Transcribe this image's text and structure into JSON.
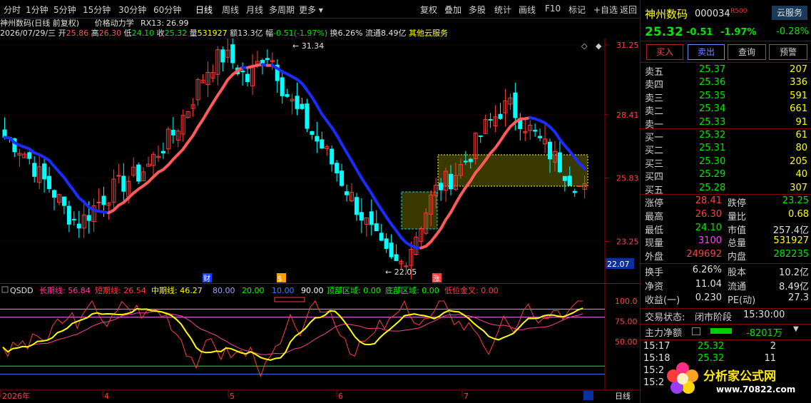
{
  "toolbar": {
    "periods": [
      "分时",
      "1分钟",
      "5分钟",
      "15分钟",
      "30分钟",
      "60分钟",
      "日线",
      "周线",
      "月线",
      "多周期",
      "更多"
    ],
    "active_period": "日线",
    "actions": [
      "复权",
      "叠加",
      "多股",
      "统计",
      "画线",
      "F10",
      "标记",
      "+自选",
      "返回"
    ]
  },
  "title_line": {
    "stock": "神州数码(日线 前复权)",
    "indicator": "价格动力学",
    "rx13_label": "RX13:",
    "rx13_value": "26.99"
  },
  "quote_line": {
    "date": "2026/07/29/三",
    "open_label": "开",
    "open": "25.86",
    "high_label": "高",
    "high": "26.30",
    "low_label": "低",
    "low": "24.10",
    "close_label": "收",
    "close": "25.32",
    "vol_label": "量",
    "vol": "531927",
    "amt_label": "额",
    "amt": "13.3亿",
    "chg_label": "幅",
    "chg": "-0.51(-1.97%)",
    "turn_label": "换",
    "turn": "6.26%",
    "float_label": "流通",
    "float": "8.49亿",
    "service": "其他云服务"
  },
  "price_axis": {
    "ticks": [
      "31.25",
      "28.41",
      "25.83",
      "23.25"
    ],
    "current": "22.07",
    "high_marker": "31.34",
    "low_marker": "22.05"
  },
  "event_markers": [
    "财",
    "$",
    "涨"
  ],
  "indicator_panel": {
    "name": "QSDD",
    "long_label": "长期线:",
    "long_value": "56.84",
    "short_label": "短期线:",
    "short_value": "26.54",
    "mid_label": "中期线:",
    "mid_value": "46.27",
    "levels": [
      "80.00",
      "20.00",
      "10.00",
      "90.00"
    ],
    "top_zone_label": "顶部区域:",
    "top_zone": "0.00",
    "bottom_zone_label": "底部区域:",
    "bottom_zone": "0.00",
    "gold_label": "低位金叉:",
    "gold": "0.00",
    "ticks": [
      "100.0",
      "75.00",
      "50.00"
    ]
  },
  "time_axis": {
    "labels": [
      "2026年",
      "4",
      "5",
      "6",
      "7"
    ],
    "period": "日线"
  },
  "right_panel": {
    "name": "神州数码",
    "code": "000034",
    "r_badge": "R500",
    "cloud_btn": "云服务",
    "price": "25.32",
    "change": "-0.51",
    "pct": "-1.97%",
    "side_pct": "-0.28%",
    "buttons": [
      "买入",
      "卖出",
      "查询",
      "预警"
    ],
    "asks": [
      {
        "label": "卖五",
        "price": "25.37",
        "vol": "207"
      },
      {
        "label": "卖四",
        "price": "25.36",
        "vol": "336"
      },
      {
        "label": "卖三",
        "price": "25.35",
        "vol": "591"
      },
      {
        "label": "卖二",
        "price": "25.34",
        "vol": "661"
      },
      {
        "label": "卖一",
        "price": "25.33",
        "vol": "91"
      }
    ],
    "bids": [
      {
        "label": "买一",
        "price": "25.32",
        "vol": "61"
      },
      {
        "label": "买二",
        "price": "25.31",
        "vol": "80"
      },
      {
        "label": "买三",
        "price": "25.30",
        "vol": "205"
      },
      {
        "label": "买四",
        "price": "25.29",
        "vol": "40"
      },
      {
        "label": "买五",
        "price": "25.28",
        "vol": "307"
      }
    ],
    "stats": [
      {
        "l1": "涨停",
        "v1": "28.41",
        "l2": "跌停",
        "v2": "23.25"
      },
      {
        "l1": "最高",
        "v1": "26.30",
        "l2": "量比",
        "v2": "0.68"
      },
      {
        "l1": "最低",
        "v1": "24.10",
        "l2": "市值",
        "v2": "257.4亿"
      },
      {
        "l1": "现量",
        "v1": "3100",
        "l2": "总量",
        "v2": "531927"
      },
      {
        "l1": "外盘",
        "v1": "249692",
        "l2": "内盘",
        "v2": "282235"
      }
    ],
    "stats2": [
      {
        "l1": "换手",
        "v1": "6.26%",
        "l2": "股本",
        "v2": "10.2亿"
      },
      {
        "l1": "净资",
        "v1": "11.04",
        "l2": "流通",
        "v2": "8.49亿"
      },
      {
        "l1": "收益(一)",
        "v1": "0.230",
        "l2": "PE(动)",
        "v2": "27.3"
      }
    ],
    "trade_status_label": "交易状态:",
    "trade_status": "闭市阶段",
    "trade_time": "15:30:00",
    "main_flow_label": "主力净额",
    "main_flow": "-8201万",
    "ticks": [
      {
        "time": "15:17",
        "price": "25.32",
        "vol": "2"
      },
      {
        "time": "15:18",
        "price": "25.32",
        "vol": "11"
      },
      {
        "time": "15:2",
        "price": "",
        "vol": ""
      },
      {
        "time": "15:2",
        "price": "",
        "vol": ""
      }
    ],
    "logo_text": "分析家公式网",
    "logo_url": "www.70822.com"
  }
}
